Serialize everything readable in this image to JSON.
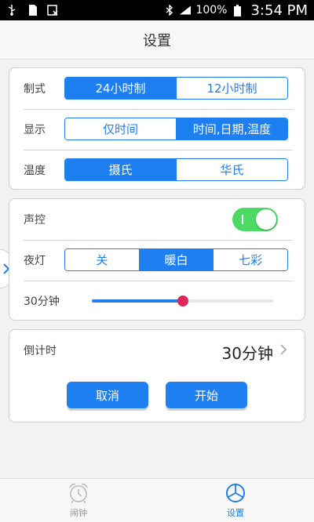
{
  "status_bar": {
    "battery": "100%",
    "time": "3:54 PM"
  },
  "header": {
    "title": "设置"
  },
  "format": {
    "label": "制式",
    "options": [
      "24小时制",
      "12小时制"
    ],
    "selected": 0
  },
  "display": {
    "label": "显示",
    "options": [
      "仅时间",
      "时间,日期,温度"
    ],
    "selected": 1
  },
  "temperature": {
    "label": "温度",
    "options": [
      "摄氏",
      "华氏"
    ],
    "selected": 0
  },
  "voice": {
    "label": "声控",
    "on": true
  },
  "nightlight": {
    "label": "夜灯",
    "options": [
      "关",
      "暖白",
      "七彩"
    ],
    "selected": 1
  },
  "duration": {
    "label": "30分钟",
    "level": 0.5
  },
  "countdown": {
    "label": "倒计时",
    "value": "30分钟",
    "cancel_label": "取消",
    "start_label": "开始"
  },
  "tabs": [
    {
      "label": "闹钟",
      "icon": "alarm-clock-icon"
    },
    {
      "label": "设置",
      "icon": "settings-dial-icon"
    }
  ],
  "colors": {
    "accent": "#1e7ff0",
    "toggle_on": "#4cd964",
    "slider_thumb": "#e0265a"
  }
}
